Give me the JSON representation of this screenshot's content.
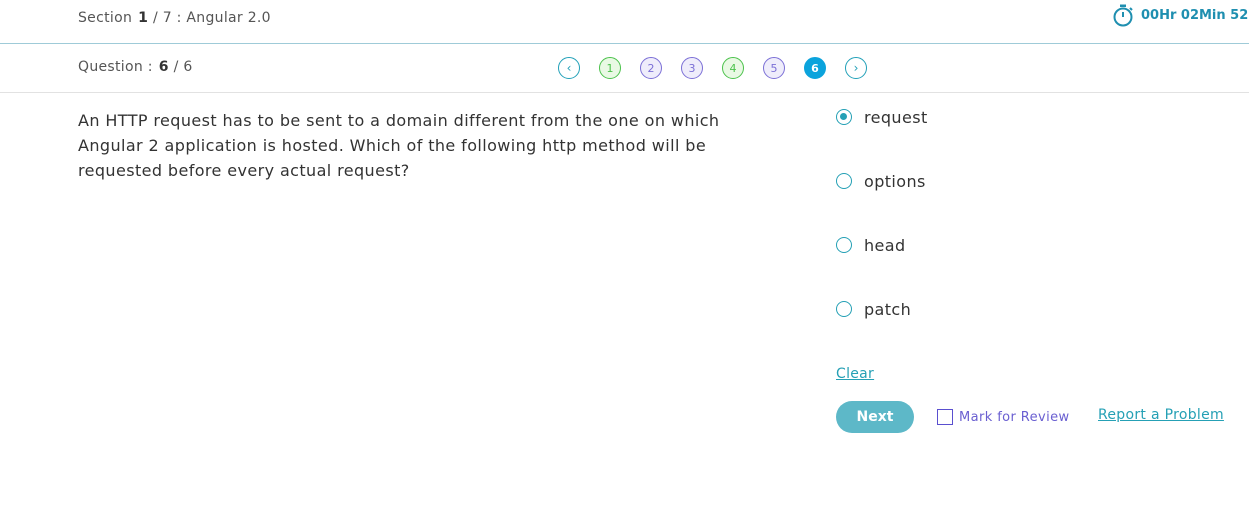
{
  "header": {
    "section_label": "Section",
    "section_current": "1",
    "section_rest": "/ 7 : Angular 2.0",
    "timer_text": "00Hr 02Min 52"
  },
  "question_bar": {
    "label": "Question :",
    "current": "6",
    "rest": "/ 6",
    "pager": {
      "prev_icon": "chevron-left-icon",
      "next_icon": "chevron-right-icon",
      "pages": [
        {
          "label": "1",
          "status": "answered"
        },
        {
          "label": "2",
          "status": "visited"
        },
        {
          "label": "3",
          "status": "visited"
        },
        {
          "label": "4",
          "status": "answered"
        },
        {
          "label": "5",
          "status": "visited"
        },
        {
          "label": "6",
          "status": "current"
        }
      ]
    }
  },
  "question": {
    "text": "An HTTP request has to be sent to a domain different from the one on which Angular 2 application is hosted. Which of the following http method will be requested before every actual request?"
  },
  "options": [
    {
      "label": "request",
      "selected": true
    },
    {
      "label": "options",
      "selected": false
    },
    {
      "label": "head",
      "selected": false
    },
    {
      "label": "patch",
      "selected": false
    }
  ],
  "actions": {
    "clear_label": "Clear",
    "next_label": "Next",
    "mark_review_label": "Mark for Review",
    "report_label": "Report a Problem"
  },
  "colors": {
    "accent": "#25a0b5",
    "answered": "#4bc24b",
    "visited": "#7b6fd6",
    "current": "#0ba3dc"
  }
}
